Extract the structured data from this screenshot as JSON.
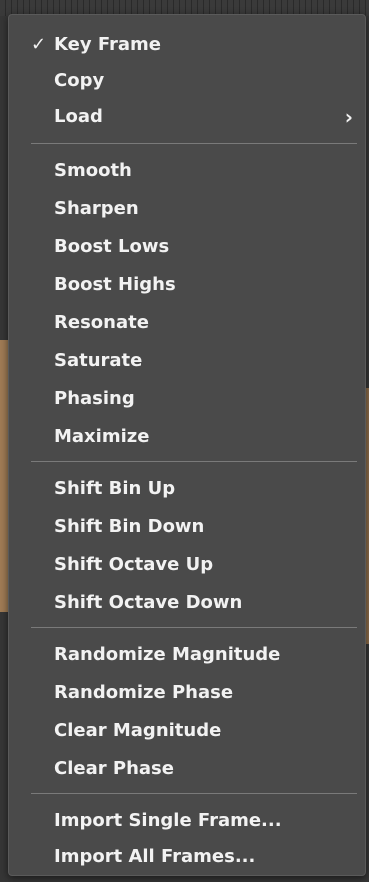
{
  "menu": {
    "group1": [
      {
        "label": "Key Frame",
        "checked": true,
        "check_glyph": "✓"
      },
      {
        "label": "Copy"
      },
      {
        "label": "Load",
        "submenu": true,
        "chevron_glyph": "›"
      }
    ],
    "group2": [
      {
        "label": "Smooth"
      },
      {
        "label": "Sharpen"
      },
      {
        "label": "Boost Lows"
      },
      {
        "label": "Boost Highs"
      },
      {
        "label": "Resonate"
      },
      {
        "label": "Saturate"
      },
      {
        "label": "Phasing"
      },
      {
        "label": "Maximize"
      }
    ],
    "group3": [
      {
        "label": "Shift Bin Up"
      },
      {
        "label": "Shift Bin Down"
      },
      {
        "label": "Shift Octave Up"
      },
      {
        "label": "Shift Octave Down"
      }
    ],
    "group4": [
      {
        "label": "Randomize Magnitude"
      },
      {
        "label": "Randomize Phase"
      },
      {
        "label": "Clear Magnitude"
      },
      {
        "label": "Clear Phase"
      }
    ],
    "group5": [
      {
        "label": "Import Single Frame..."
      },
      {
        "label": "Import All Frames..."
      }
    ]
  },
  "colors": {
    "menu_background": "#4a4a4a",
    "text": "#f2f2f2",
    "separator": "#7a7a7a",
    "accent": "#a07c55"
  }
}
